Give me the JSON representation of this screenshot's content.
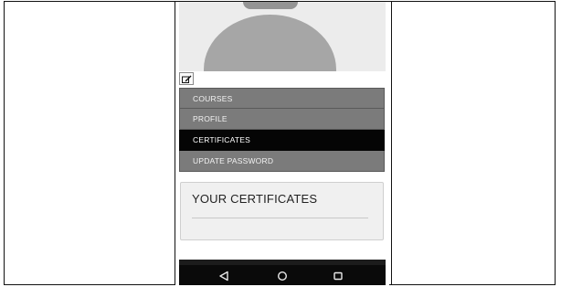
{
  "menu": {
    "items": [
      {
        "label": "COURSES",
        "active": false
      },
      {
        "label": "PROFILE",
        "active": false
      },
      {
        "label": "CERTIFICATES",
        "active": true
      },
      {
        "label": "UPDATE PASSWORD",
        "active": false
      }
    ]
  },
  "certificates_card": {
    "title": "YOUR CERTIFICATES"
  },
  "icons": {
    "edit": "edit-icon",
    "back": "back-icon",
    "home": "home-icon",
    "recents": "recents-icon"
  },
  "colors": {
    "menu_bg": "#7b7b7b",
    "menu_active_bg": "#050505",
    "avatar_bg": "#ececec",
    "avatar_shape": "#a6a6a6",
    "navbar_bg": "#0a0a0a"
  }
}
